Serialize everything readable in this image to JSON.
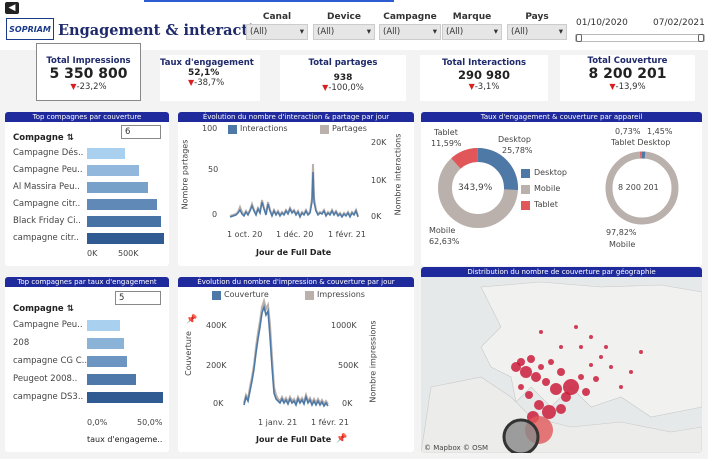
{
  "header": {
    "title": "Engagement & interactions",
    "logo": "SOPRIAM"
  },
  "filters": [
    {
      "label": "Canal",
      "value": "(All)"
    },
    {
      "label": "Device",
      "value": "(All)"
    },
    {
      "label": "Campagne",
      "value": "(All)"
    },
    {
      "label": "Marque",
      "value": "(All)"
    },
    {
      "label": "Pays",
      "value": "(All)"
    }
  ],
  "date_range": {
    "start": "01/10/2020",
    "end": "07/02/2021"
  },
  "kpis": [
    {
      "title": "Total Impressions",
      "value": "5 350 800",
      "delta": "-23,2%"
    },
    {
      "title": "Taux d'engagement",
      "value": "52,1%",
      "delta": "-38,7%"
    },
    {
      "title": "Total partages",
      "value": "938",
      "delta": "-100,0%"
    },
    {
      "title": "Total Interactions",
      "value": "290 980",
      "delta": "-3,1%"
    },
    {
      "title": "Total Couverture",
      "value": "8 200 201",
      "delta": "-13,9%"
    }
  ],
  "top_couverture": {
    "title": "Top compagnes par couverture",
    "header_label": "Compagne",
    "input_value": "6",
    "axis_ticks": [
      "0K",
      "500K"
    ],
    "rows": [
      {
        "label": "Campagne Dés..",
        "value": 0.42
      },
      {
        "label": "Campagne Peu..",
        "value": 0.58
      },
      {
        "label": "Al Massira Peu..",
        "value": 0.68
      },
      {
        "label": "Campagne citr..",
        "value": 0.78
      },
      {
        "label": "Black Friday Ci..",
        "value": 0.82
      },
      {
        "label": "campagne citr..",
        "value": 0.86
      }
    ]
  },
  "top_engagement": {
    "title": "Top compagnes par taux d'engagement",
    "header_label": "Compagne",
    "input_value": "5",
    "axis_ticks": [
      "0,0%",
      "50,0%"
    ],
    "axis_label": "taux d'engageme..",
    "rows": [
      {
        "label": "Campagne Peu..",
        "value": 0.38
      },
      {
        "label": "208",
        "value": 0.43
      },
      {
        "label": "campagne CG C..",
        "value": 0.46
      },
      {
        "label": "Peugeot 2008..",
        "value": 0.57
      },
      {
        "label": "campagne DS3..",
        "value": 0.88
      }
    ]
  },
  "chart_interactions": {
    "title": "Évolution du nombre d'interaction & partage par jour",
    "legend": [
      "Interactions",
      "Partages"
    ],
    "ylabel_left": "Nombre partages",
    "ylabel_right": "Nombre interactions",
    "yticks_left": [
      "100",
      "50",
      "0"
    ],
    "yticks_right": [
      "20K",
      "10K",
      "0K"
    ],
    "xticks": [
      "1 oct. 20",
      "1 déc. 20",
      "1 févr. 21"
    ],
    "xlabel": "Jour de Full Date"
  },
  "chart_impressions": {
    "title": "Évolution du nombre d'impression & couverture par jour",
    "legend": [
      "Couverture",
      "Impressions"
    ],
    "ylabel_left": "Couverture",
    "ylabel_right": "Nombre impressions",
    "yticks_left": [
      "400K",
      "200K",
      "0K"
    ],
    "yticks_right": [
      "1000K",
      "500K",
      "0K"
    ],
    "xticks": [
      "1 janv. 21",
      "1 févr. 21"
    ],
    "xlabel": "Jour de Full Date"
  },
  "device": {
    "title": "Taux d'engagement & couverture par appareil",
    "legend": [
      "Desktop",
      "Mobile",
      "Tablet"
    ],
    "donut1": {
      "center": "343,9%",
      "tablet_label": "Tablet",
      "tablet_pct": "11,59%",
      "desktop_label": "Desktop",
      "desktop_pct": "25,78%",
      "mobile_label": "Mobile",
      "mobile_pct": "62,63%"
    },
    "donut2": {
      "center": "8 200 201",
      "tablet_pct": "0,73%",
      "desktop_pct": "1,45%",
      "top_labels": "Tablet Desktop",
      "mobile_pct": "97,82%",
      "mobile_label": "Mobile"
    }
  },
  "map": {
    "title": "Distribution du nombre de couverture par géographie",
    "credit": "© Mapbox © OSM"
  },
  "colors": {
    "navy": "#1f2a9c",
    "desktop": "#4e79a7",
    "mobile": "#bab0ac",
    "tablet": "#e15759",
    "bar_dark": "#2f5a92",
    "bar_light": "#a9d0ef"
  }
}
